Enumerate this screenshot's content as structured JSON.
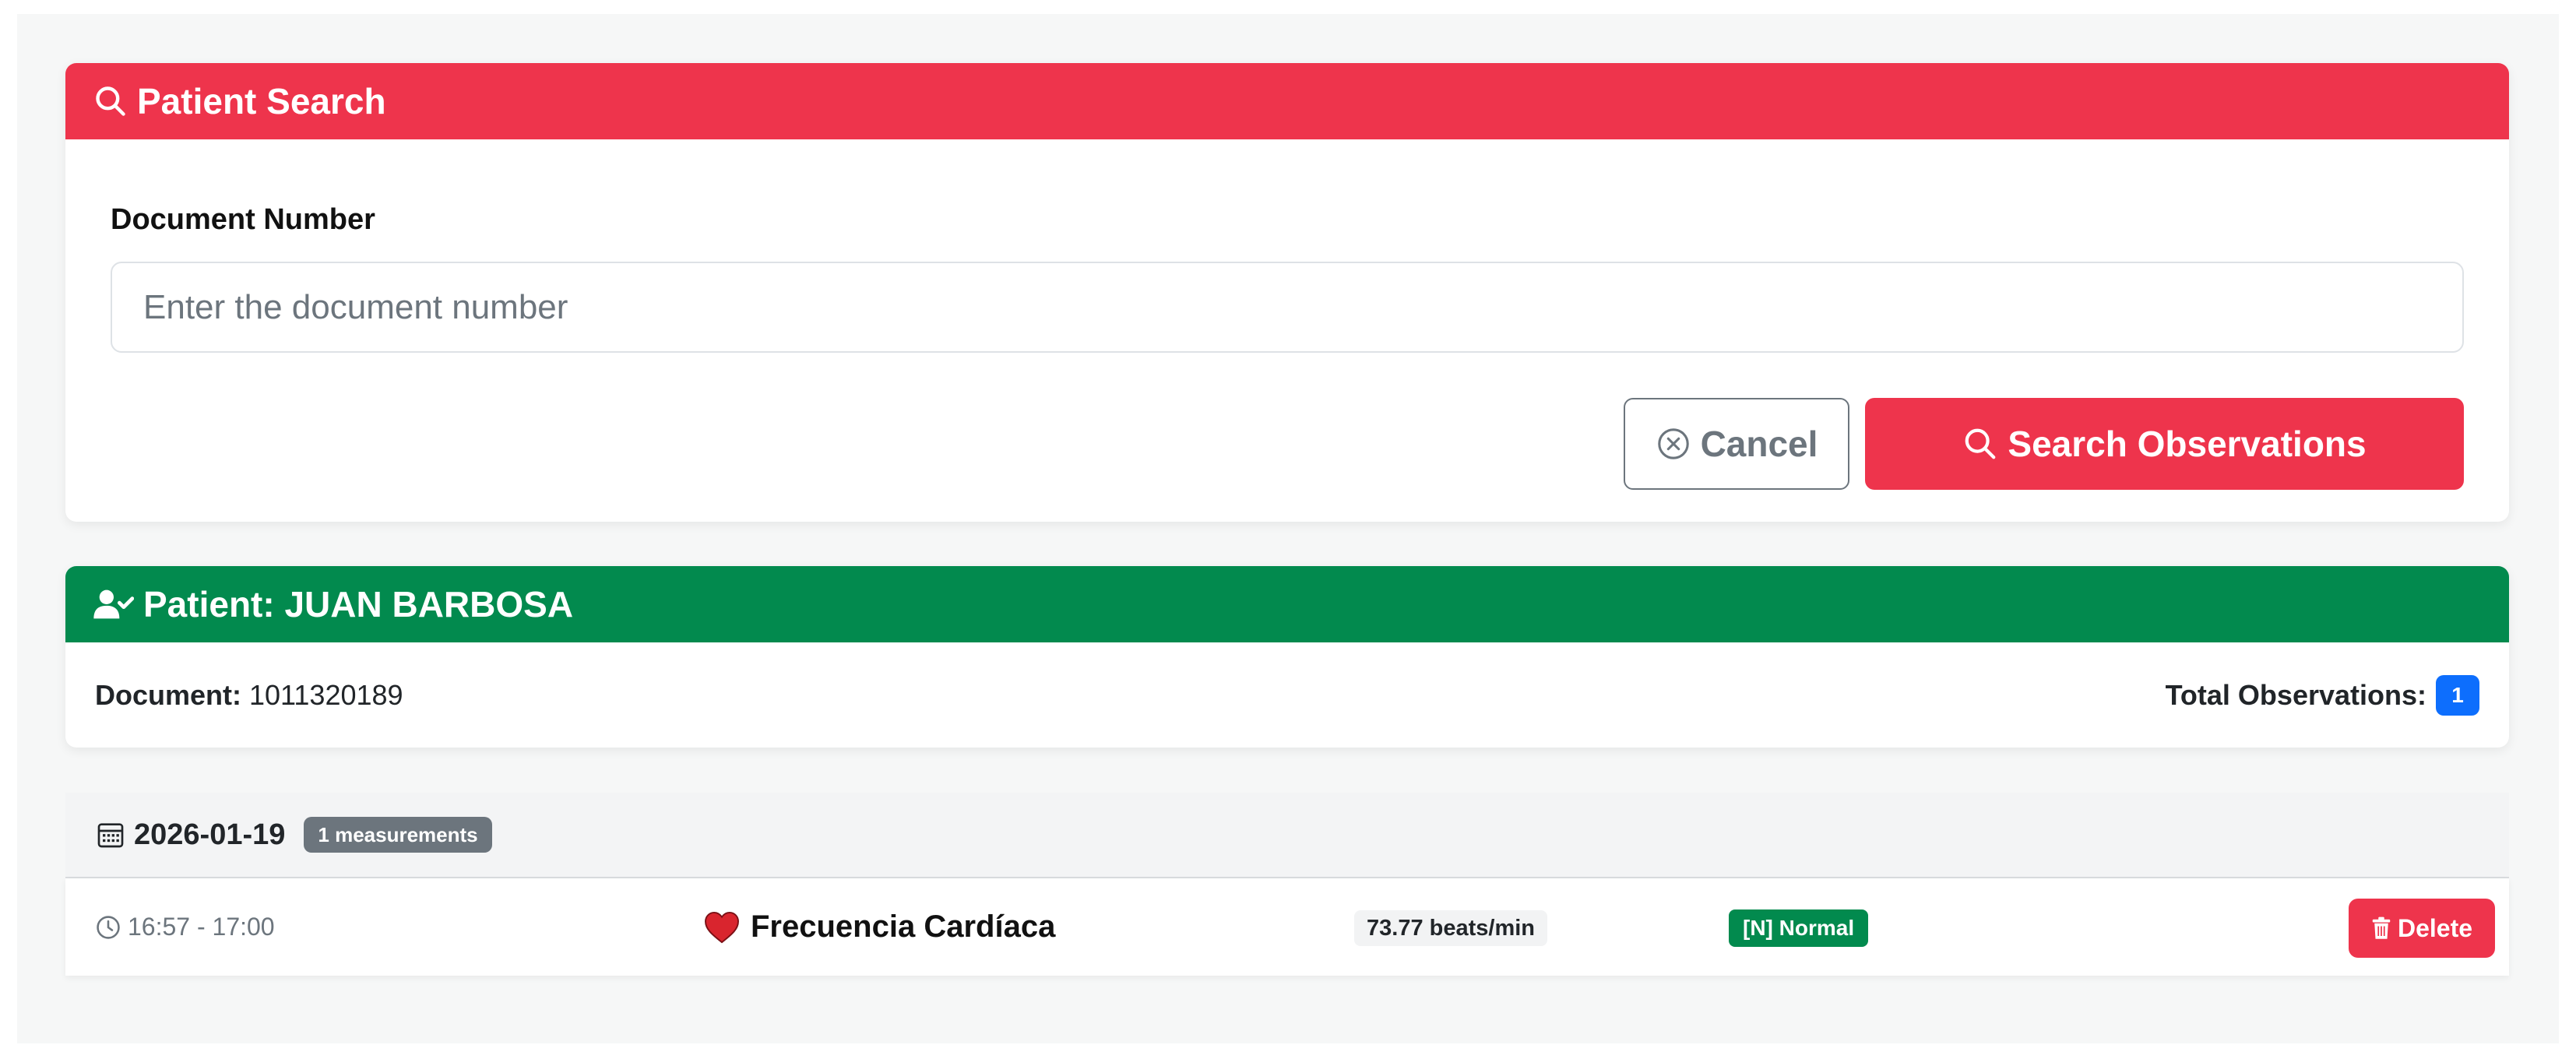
{
  "search_card": {
    "title": "Patient Search",
    "field_label": "Document Number",
    "input_value": "",
    "input_placeholder": "Enter the document number",
    "cancel_label": "Cancel",
    "search_label": "Search Observations"
  },
  "patient_card": {
    "title": "Patient: JUAN BARBOSA",
    "document_label": "Document:",
    "document_value": "1011320189",
    "total_label": "Total Observations:",
    "total_value": "1"
  },
  "observation_groups": [
    {
      "date": "2026-01-19",
      "count_badge": "1 measurements",
      "observations": [
        {
          "time_range": "16:57 - 17:00",
          "name": "Frecuencia Cardíaca",
          "value": "73.77 beats/min",
          "status": "[N] Normal",
          "delete_label": "Delete"
        }
      ]
    }
  ],
  "icons": {
    "search_header": "search-icon",
    "patient_header": "user-check-icon",
    "cancel": "x-circle-icon",
    "search_button": "search-icon",
    "calendar": "calendar-icon",
    "clock": "clock-icon",
    "heart": "heart-icon",
    "trash": "trash-icon"
  },
  "colors": {
    "primary_red": "#ee344c",
    "success_green": "#028a4e",
    "info_blue": "#0d6efd",
    "secondary_gray": "#6c757d",
    "heart_red": "#d9252e"
  }
}
